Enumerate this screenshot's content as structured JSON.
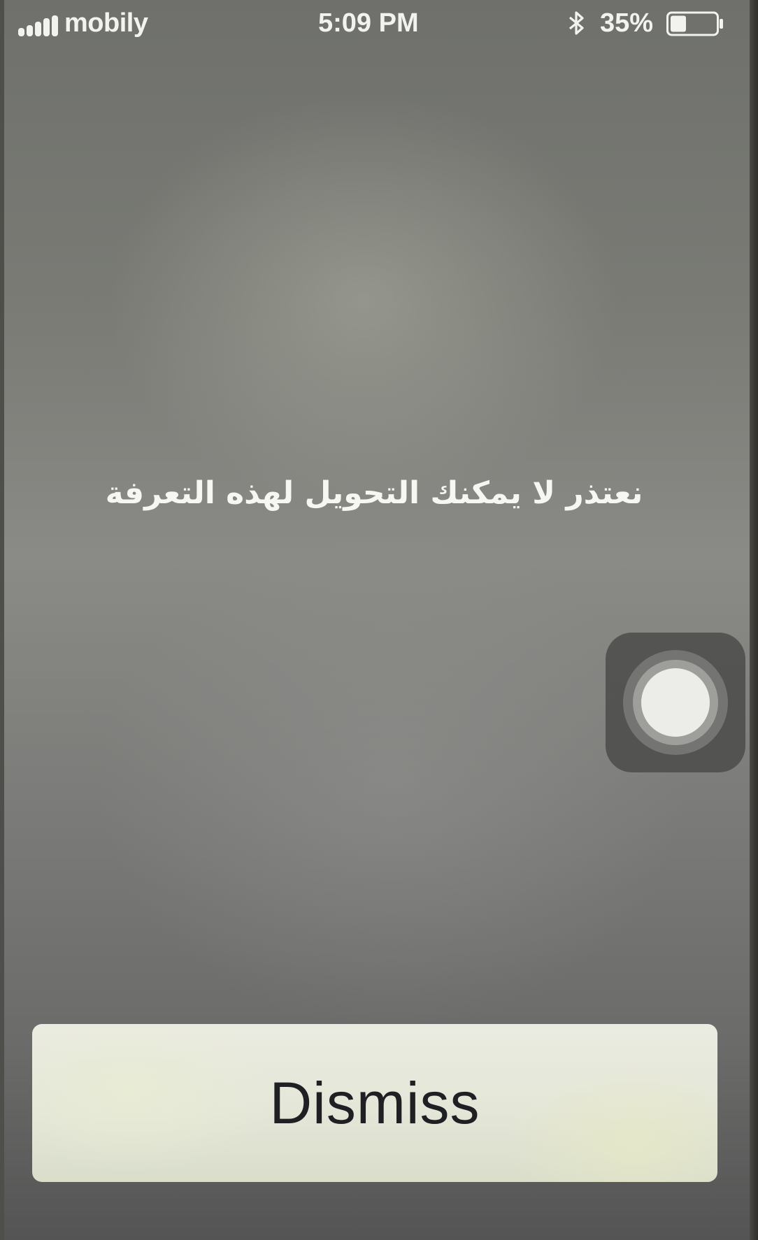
{
  "status_bar": {
    "carrier": "mobily",
    "time": "5:09 PM",
    "battery_percent": "35%",
    "battery_level": 0.35,
    "signal_bars": 5,
    "icons": [
      "signal-icon",
      "bluetooth-icon",
      "battery-icon"
    ]
  },
  "alert": {
    "message": "نعتذر لا يمكنك التحويل لهذه التعرفة",
    "dismiss_label": "Dismiss"
  },
  "assistive_touch": {
    "icon": "assistive-touch-icon"
  }
}
